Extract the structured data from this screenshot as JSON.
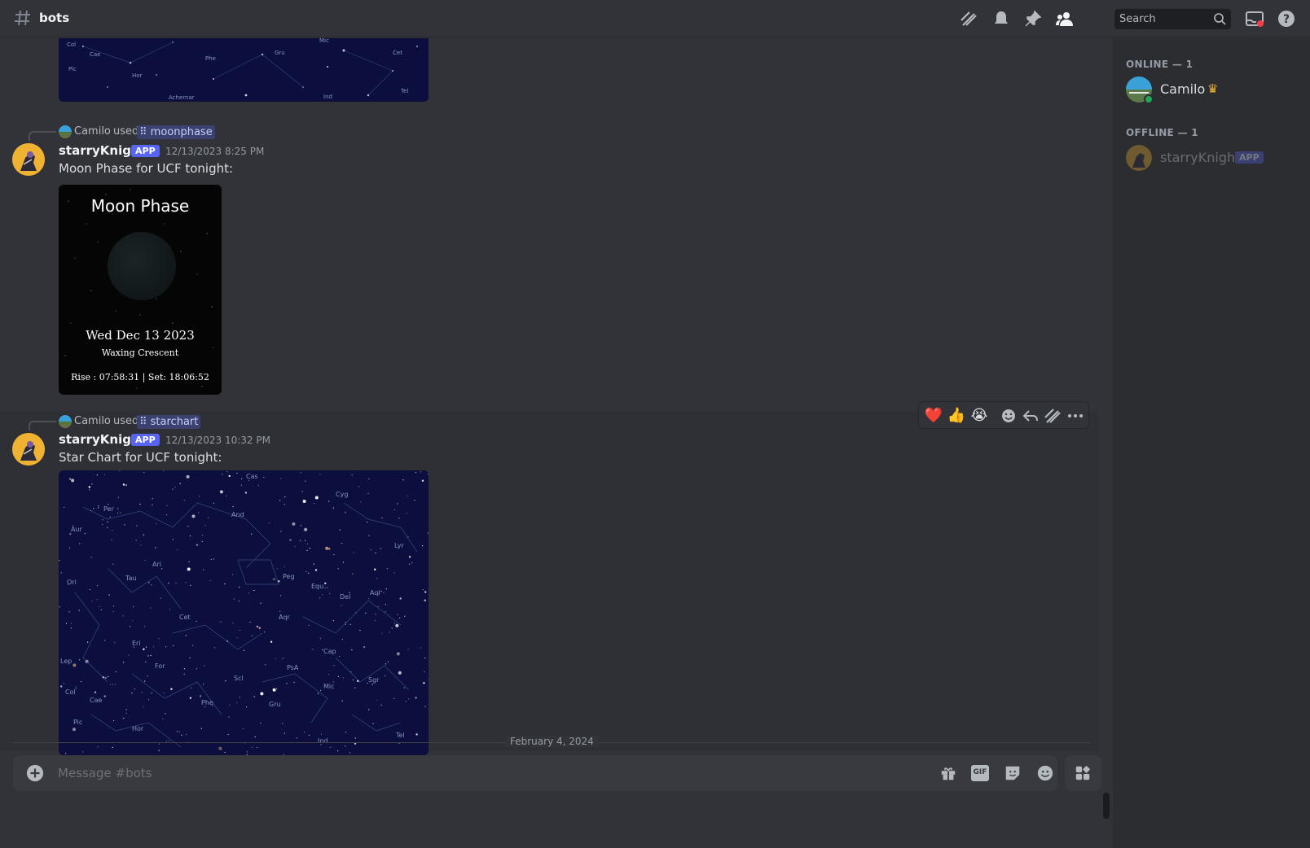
{
  "header": {
    "channel_name": "bots",
    "search_placeholder": "Search"
  },
  "messages": [
    {
      "reply_user": "Camilo",
      "reply_text": "used",
      "command": "moonphase",
      "author": "starryKnight",
      "badge": "APP",
      "timestamp": "12/13/2023 8:25 PM",
      "text": "Moon Phase for UCF tonight:",
      "moon_card": {
        "title": "Moon Phase",
        "date": "Wed Dec 13 2023",
        "phase": "Waxing Crescent",
        "rise_set": "Rise : 07:58:31 | Set: 18:06:52"
      }
    },
    {
      "reply_user": "Camilo",
      "reply_text": "used",
      "command": "starchart",
      "author": "starryKnight",
      "badge": "APP",
      "timestamp": "12/13/2023 10:32 PM",
      "text": "Star Chart for UCF tonight:"
    }
  ],
  "starchart_labels": [
    "Cas",
    "Cyg",
    "Per",
    "And",
    "Aur",
    "Tau",
    "Ari",
    "Peg",
    "Ori",
    "Cet",
    "Aqr",
    "Aql",
    "Eri",
    "Cap",
    "Sgr",
    "Mic",
    "Gru",
    "Phe",
    "Hor",
    "Tel",
    "Ind",
    "For",
    "Lep",
    "Scl",
    "PsA",
    "Del",
    "Equ",
    "Lyr",
    "Col",
    "Cae",
    "Pic"
  ],
  "reactions": {
    "heart": "❤️",
    "thumbs_up": "👍",
    "crying": "😭"
  },
  "date_divider": "February 4, 2024",
  "composer": {
    "placeholder": "Message #bots",
    "gif_label": "GIF"
  },
  "members": {
    "online_title": "ONLINE — 1",
    "offline_title": "OFFLINE — 1",
    "online": [
      {
        "name": "Camilo",
        "crown": "♛"
      }
    ],
    "offline": [
      {
        "name": "starryKnight",
        "badge": "APP"
      }
    ]
  },
  "colors": {
    "background": "#313338",
    "sidebar": "#2b2d31",
    "accent": "#5865f2",
    "online": "#23a55a"
  }
}
